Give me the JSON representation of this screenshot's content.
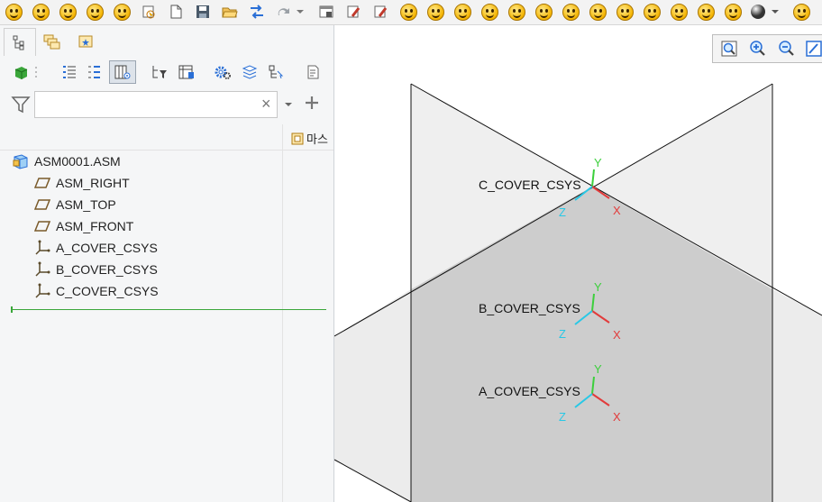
{
  "toolbar": {
    "icons": [
      "smiley-icon",
      "smiley-icon",
      "smiley-icon",
      "smiley-icon",
      "smiley-icon",
      "regenerate-icon",
      "new-file-icon",
      "save-icon",
      "open-icon",
      "swap-icon",
      "redo-icon",
      "dropdown-arrow-icon",
      "window-icon",
      "erase-icon",
      "erase-icon",
      "smiley-icon",
      "smiley-icon",
      "smiley-icon",
      "smiley-icon",
      "smiley-icon",
      "smiley-icon",
      "smiley-icon",
      "smiley-icon",
      "smiley-icon",
      "smiley-icon",
      "smiley-icon",
      "sphere-icon",
      "dropdown-arrow-icon",
      "smiley-icon"
    ]
  },
  "panel": {
    "tabs": [
      "model-tree-tab",
      "layers-tab",
      "favorites-tab"
    ],
    "column_header": "마스"
  },
  "search": {
    "value": "",
    "clear_glyph": "×"
  },
  "tree": {
    "root": "ASM0001.ASM",
    "items": [
      {
        "label": "ASM_RIGHT",
        "type": "datum-plane"
      },
      {
        "label": "ASM_TOP",
        "type": "datum-plane"
      },
      {
        "label": "ASM_FRONT",
        "type": "datum-plane"
      },
      {
        "label": "A_COVER_CSYS",
        "type": "csys"
      },
      {
        "label": "B_COVER_CSYS",
        "type": "csys"
      },
      {
        "label": "C_COVER_CSYS",
        "type": "csys"
      }
    ]
  },
  "viewport": {
    "csys": [
      {
        "name": "C_COVER_CSYS"
      },
      {
        "name": "B_COVER_CSYS"
      },
      {
        "name": "A_COVER_CSYS"
      }
    ],
    "axes": {
      "x": "X",
      "y": "Y",
      "z": "Z"
    }
  },
  "colors": {
    "x_axis": "#e23b3b",
    "y_axis": "#3ccf3c",
    "z_axis": "#28c8e6",
    "plane_fill": "#e8e8e8",
    "plane_dark": "#c9c9c9",
    "insert_line": "#3aa63a"
  }
}
